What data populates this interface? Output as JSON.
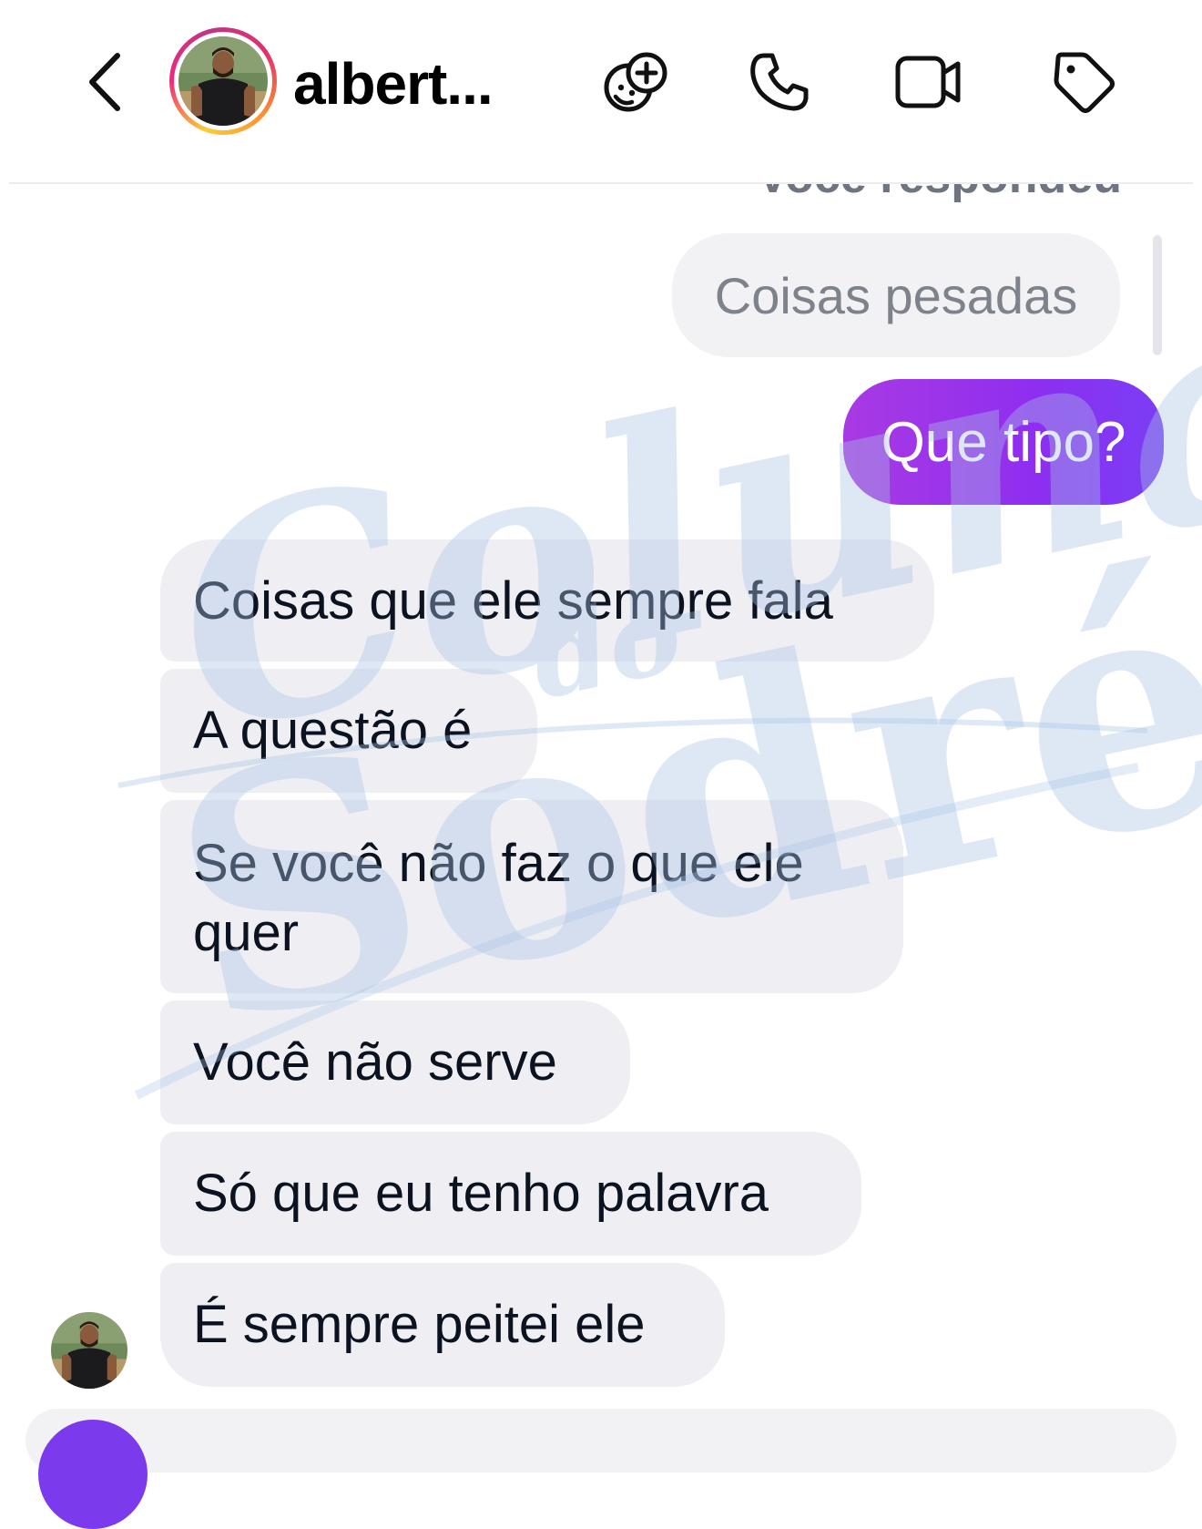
{
  "header": {
    "username": "albert...",
    "icons": {
      "back": "chevron-left-icon",
      "effects": "effects-sticker-icon",
      "call": "phone-icon",
      "video": "video-camera-icon",
      "tag": "tag-icon"
    }
  },
  "thread": {
    "replied_label": "Você respondeu",
    "replied_to_text": "Coisas pesadas",
    "sent_message": "Que tipo?",
    "received_messages": [
      "Coisas que ele sempre fala",
      "A questão é",
      "Se você não faz o que ele quer",
      "Você não serve",
      "Só que eu tenho palavra",
      "É sempre peitei ele"
    ]
  },
  "watermark": {
    "line1": "Coluna",
    "line2": "do",
    "line3": "Sodré"
  },
  "colors": {
    "sent_bubble": "#9b34ea",
    "received_bubble": "#efeff3",
    "reply_bubble": "#f2f2f5",
    "watermark": "#a9c4e6"
  }
}
